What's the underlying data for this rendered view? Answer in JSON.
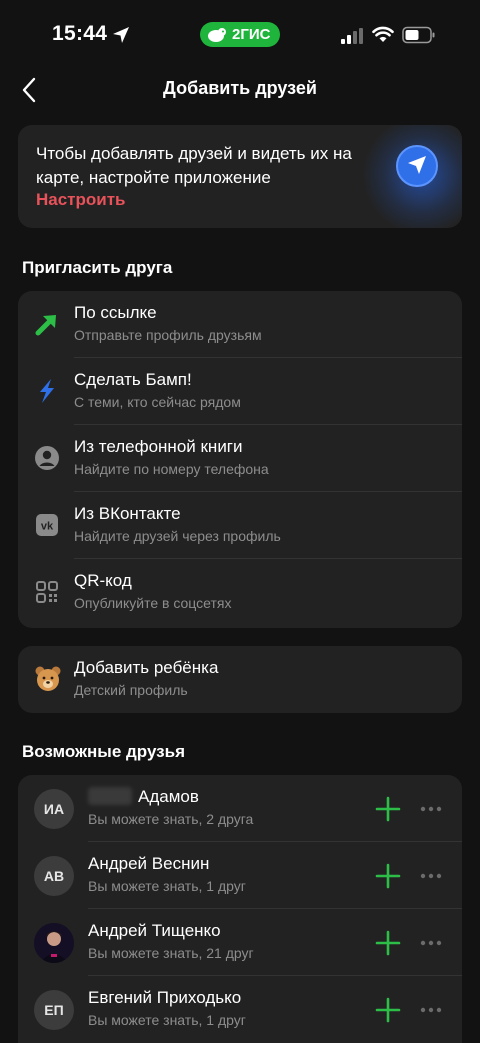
{
  "status_bar": {
    "time": "15:44",
    "app_badge": "2ГИС"
  },
  "header": {
    "title": "Добавить друзей"
  },
  "banner": {
    "text": "Чтобы добавлять друзей и видеть их на карте, настройте приложение",
    "action": "Настроить"
  },
  "invite": {
    "title": "Пригласить друга",
    "items": [
      {
        "title": "По ссылке",
        "subtitle": "Отправьте профиль друзьям",
        "icon": "green-arrow-icon"
      },
      {
        "title": "Сделать Бамп!",
        "subtitle": "С теми, кто сейчас рядом",
        "icon": "lightning-icon"
      },
      {
        "title": "Из телефонной книги",
        "subtitle": "Найдите по номеру телефона",
        "icon": "contact-person-icon"
      },
      {
        "title": "Из ВКонтакте",
        "subtitle": "Найдите друзей через профиль",
        "icon": "vk-icon"
      },
      {
        "title": "QR-код",
        "subtitle": "Опубликуйте в соцсетях",
        "icon": "qr-code-icon"
      }
    ]
  },
  "child": {
    "title": "Добавить ребёнка",
    "subtitle": "Детский профиль",
    "icon": "bear-icon"
  },
  "friends": {
    "title": "Возможные друзья",
    "items": [
      {
        "initials": "ИА",
        "name": "Адамов",
        "subtitle": "Вы можете знать, 2 друга"
      },
      {
        "initials": "АВ",
        "name": "Андрей Веснин",
        "subtitle": "Вы можете знать, 1 друг"
      },
      {
        "initials": "",
        "name": "Андрей Тищенко",
        "subtitle": "Вы можете знать, 21 друг"
      },
      {
        "initials": "ЕП",
        "name": "Евгений Приходько",
        "subtitle": "Вы можете знать, 1 друг"
      }
    ]
  },
  "colors": {
    "background": "#121212",
    "card": "#222222",
    "accent_green": "#2dbe48",
    "action_red": "#e8525a",
    "secondary_text": "#8d8d8d"
  }
}
